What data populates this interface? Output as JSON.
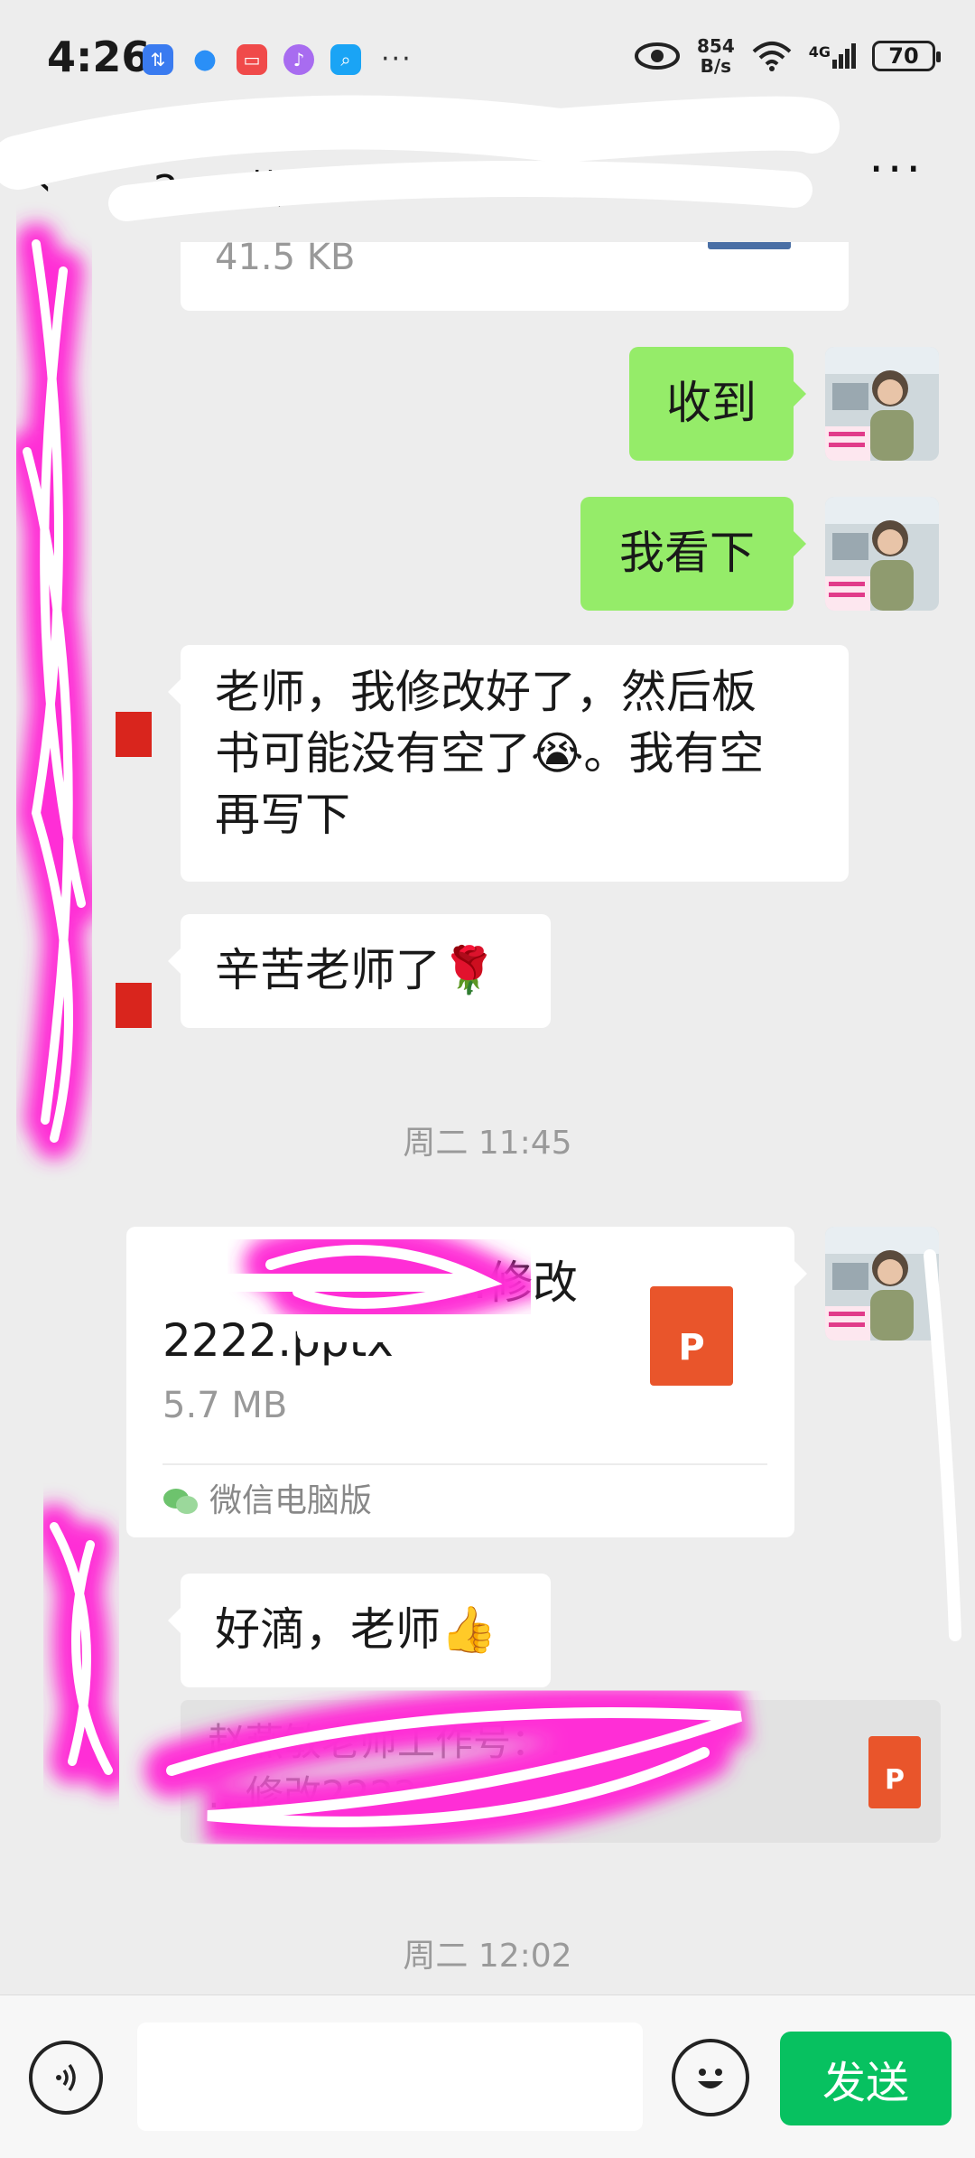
{
  "status_bar": {
    "time": "4:26",
    "net_speed_value": "854",
    "net_speed_unit": "B/s",
    "network": "4G",
    "battery": "70"
  },
  "header": {
    "title": "2 … 获",
    "more": "···"
  },
  "messages": {
    "prev_file_size": "41.5 KB",
    "m1": "收到",
    "m2": "我看下",
    "m3_line1": "老师，我修改好了，然后板",
    "m3_line2": "书可能没有空了😭。我有空",
    "m3_line3": "再写下",
    "m4": "辛苦老师了🌹",
    "time1": "周二 11:45",
    "file_name_line1": "…修改",
    "file_name_line2": "2222.pptx",
    "file_size": "5.7 MB",
    "file_source": "微信电脑版",
    "file_type": "P",
    "m5": "好滴，老师👍",
    "quote_line1": "赵燕敏老师工作号：…详",
    "quote_line2": "…修改2222.pptx",
    "time2": "周二 12:02"
  },
  "input": {
    "placeholder": "",
    "send_label": "发送"
  },
  "colors": {
    "self_bubble": "#95ec69",
    "send_button": "#07c160",
    "ppt_icon": "#e9552b",
    "redaction": "#ff2fd6"
  }
}
